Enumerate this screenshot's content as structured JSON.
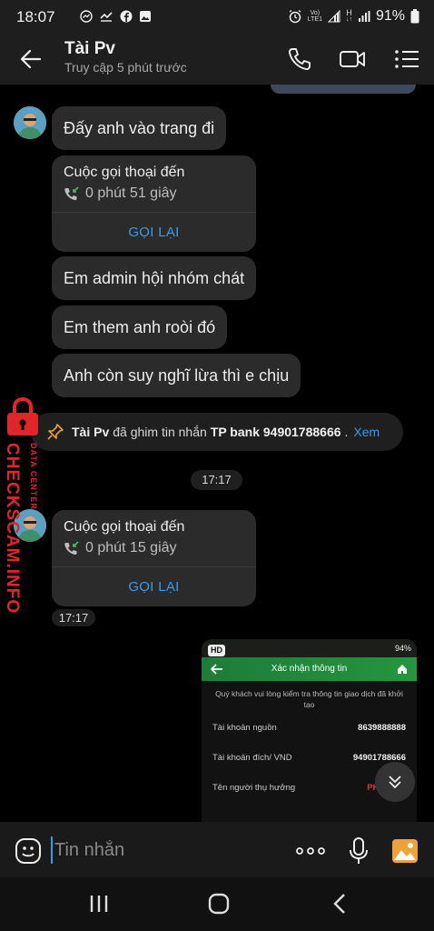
{
  "status_bar": {
    "time": "18:07",
    "network_label_top": "Vo)",
    "network_label_bottom": "LTE1",
    "h_label": "H",
    "battery": "91%",
    "left_icons": [
      "messenger-icon",
      "missed-call-icon",
      "facebook-icon",
      "image-icon"
    ]
  },
  "header": {
    "contact_name": "Tài Pv",
    "contact_status": "Truy cập 5 phút trước",
    "icons": [
      "back-arrow-icon",
      "phone-icon",
      "video-call-icon",
      "menu-icon"
    ]
  },
  "messages": {
    "m1": "Đấy anh vào trang đi",
    "call1": {
      "title": "Cuộc gọi thoại đến",
      "duration": "0 phút 51 giây",
      "action": "GỌI LẠI"
    },
    "m2": "Em admin hội nhóm chát",
    "m3": "Em them anh roòi đó",
    "m4": "Anh còn suy nghĩ lừa thì e chịu",
    "pin": {
      "name": "Tài Pv",
      "text": "đã ghim tin nhắn",
      "pinned": "TP bank 94901788666",
      "dot": ".",
      "link": "Xem"
    },
    "time_chip": "17:17",
    "call2": {
      "title": "Cuộc gọi thoại đến",
      "duration": "0 phút 15 giây",
      "action": "GỌI LẠI"
    },
    "call2_time": "17:17"
  },
  "watermark": {
    "brand": "CHECKSCAM.INFO",
    "sub": "DATA CENTER"
  },
  "screenshot_attachment": {
    "badge": "HD",
    "battery": "94%",
    "title": "Xác nhận thông tin",
    "note": "Quý khách vui lòng kiểm tra thông tin giao dịch đã khởi tạo",
    "rows": [
      {
        "label": "Tài khoản nguồn",
        "value": "8639888888"
      },
      {
        "label": "Tài khoản đích/ VND",
        "value": "94901788666"
      },
      {
        "label": "Tên người thụ hưởng",
        "value": "PHAN VĂ"
      }
    ]
  },
  "input": {
    "placeholder": "Tin nhắn"
  },
  "colors": {
    "accent": "#3b9be6",
    "bubble": "#2b2b2b",
    "header_bg": "#1e1e1e",
    "watermark_red": "#e0262b"
  }
}
